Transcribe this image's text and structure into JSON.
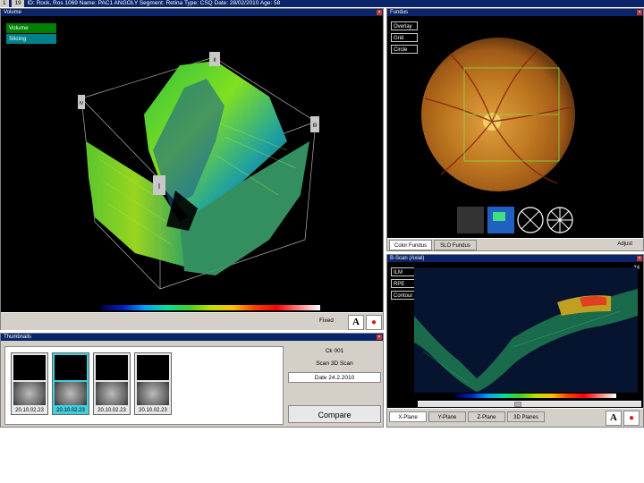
{
  "app": {
    "tab1": "1",
    "tab2": "19",
    "title": "ID: Rock, Ros 1069   Name: PAC1 ANGOLY   Segment: Retina   Type: CSQ   Date: 28/02/2010   Age: 58"
  },
  "volume_panel": {
    "title": "Volume",
    "modes": [
      "Volume",
      "Slicing"
    ],
    "bottom_label": "Fixed",
    "axis_markers": [
      "I",
      "II",
      "III",
      "IV"
    ]
  },
  "fundus_panel": {
    "title": "Fundus",
    "options": [
      "Overlay",
      "Grid",
      "Circle"
    ],
    "bottom_tabs": [
      "Color Fundus",
      "SLO Fundus"
    ],
    "bottom_right": "Adjust"
  },
  "bscan_panel": {
    "title": "B-Scan (Axial)",
    "options": [
      "ILM",
      "RPE",
      "Contour"
    ],
    "scale_value": "-34",
    "tabs": [
      "X-Plane",
      "Y-Plane",
      "Z-Plane",
      "3D Planes"
    ]
  },
  "thumbnails_panel": {
    "title": "Thumbnails",
    "items": [
      {
        "date": "20.10.02.23"
      },
      {
        "date": "20.10.02.23"
      },
      {
        "date": "20.10.02.23"
      },
      {
        "date": "20.10.02.23"
      }
    ],
    "info_top": "Ck 001",
    "scan_type": "Scan 3D Scan",
    "date_box": "Date 24.2.2010",
    "compare": "Compare"
  },
  "colors": {
    "accent_green": "#008000",
    "accent_teal": "#00808a",
    "selected_thumb": "#40d0e0",
    "title_blue": "#0a246a"
  }
}
